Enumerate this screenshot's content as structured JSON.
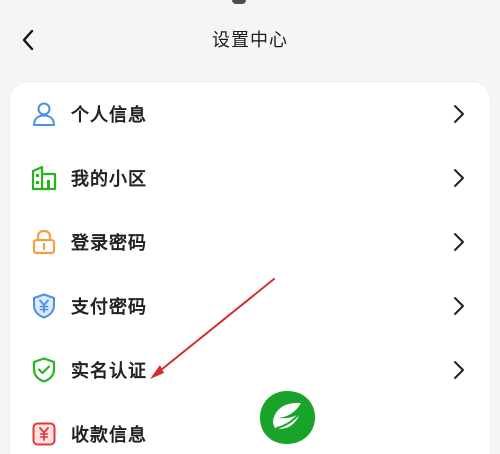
{
  "header": {
    "title": "设置中心",
    "back_icon": "chevron-left-icon"
  },
  "settings": {
    "items": [
      {
        "label": "个人信息",
        "icon": "user-icon",
        "icon_color": "#4a90e2"
      },
      {
        "label": "我的小区",
        "icon": "building-icon",
        "icon_color": "#27b51f"
      },
      {
        "label": "登录密码",
        "icon": "lock-icon",
        "icon_color": "#f0a040"
      },
      {
        "label": "支付密码",
        "icon": "shield-yuan-icon",
        "icon_color": "#4a90e2"
      },
      {
        "label": "实名认证",
        "icon": "shield-check-icon",
        "icon_color": "#27b51f"
      },
      {
        "label": "收款信息",
        "icon": "yuan-card-icon",
        "icon_color": "#e53935"
      }
    ]
  },
  "colors": {
    "annotation_arrow": "#d32f2f",
    "logo_green": "#18a32a"
  }
}
